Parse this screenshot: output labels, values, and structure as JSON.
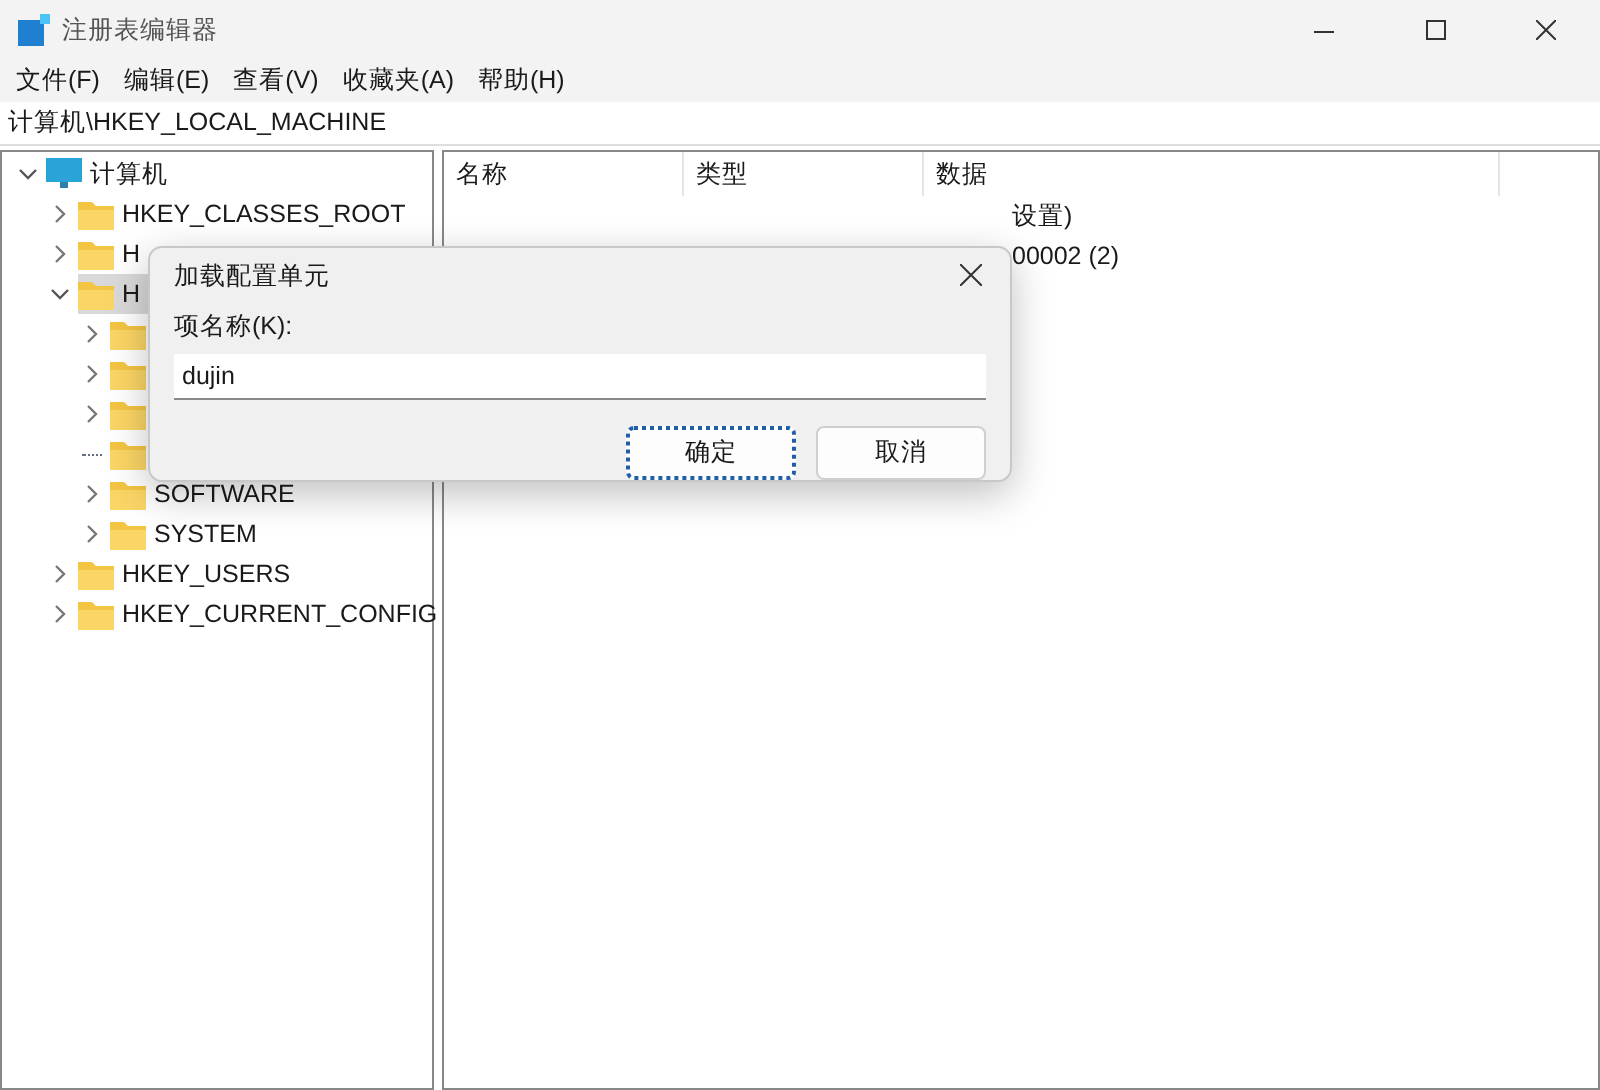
{
  "window": {
    "title": "注册表编辑器"
  },
  "menu": [
    "文件(F)",
    "编辑(E)",
    "查看(V)",
    "收藏夹(A)",
    "帮助(H)"
  ],
  "address": "计算机\\HKEY_LOCAL_MACHINE",
  "tree": {
    "label": "计算机",
    "expanded": true,
    "selected": false,
    "children": [
      {
        "label": "HKEY_CLASSES_ROOT",
        "expanded": false,
        "selected": false
      },
      {
        "label": "H",
        "expanded": false,
        "selected": false
      },
      {
        "label": "H",
        "expanded": true,
        "selected": true,
        "children": [
          {
            "expanded": false,
            "selected": false
          },
          {
            "expanded": false,
            "selected": false
          },
          {
            "expanded": false,
            "selected": false
          },
          {
            "selected": false
          },
          {
            "label": "SOFTWARE",
            "expanded": false,
            "selected": false
          },
          {
            "label": "SYSTEM",
            "expanded": false,
            "selected": false
          }
        ]
      },
      {
        "label": "HKEY_USERS",
        "expanded": false,
        "selected": false
      },
      {
        "label": "HKEY_CURRENT_CONFIG",
        "expanded": false,
        "selected": false
      }
    ]
  },
  "columns": [
    "名称",
    "类型",
    "数据"
  ],
  "values": [
    {
      "data": "设置)"
    },
    {
      "data": "00002 (2)"
    }
  ],
  "dialog": {
    "title": "加载配置单元",
    "field_label": "项名称(K):",
    "value": "dujin",
    "buttons": [
      {
        "label": "确定",
        "default": true
      },
      {
        "label": "取消",
        "default": false
      }
    ]
  }
}
